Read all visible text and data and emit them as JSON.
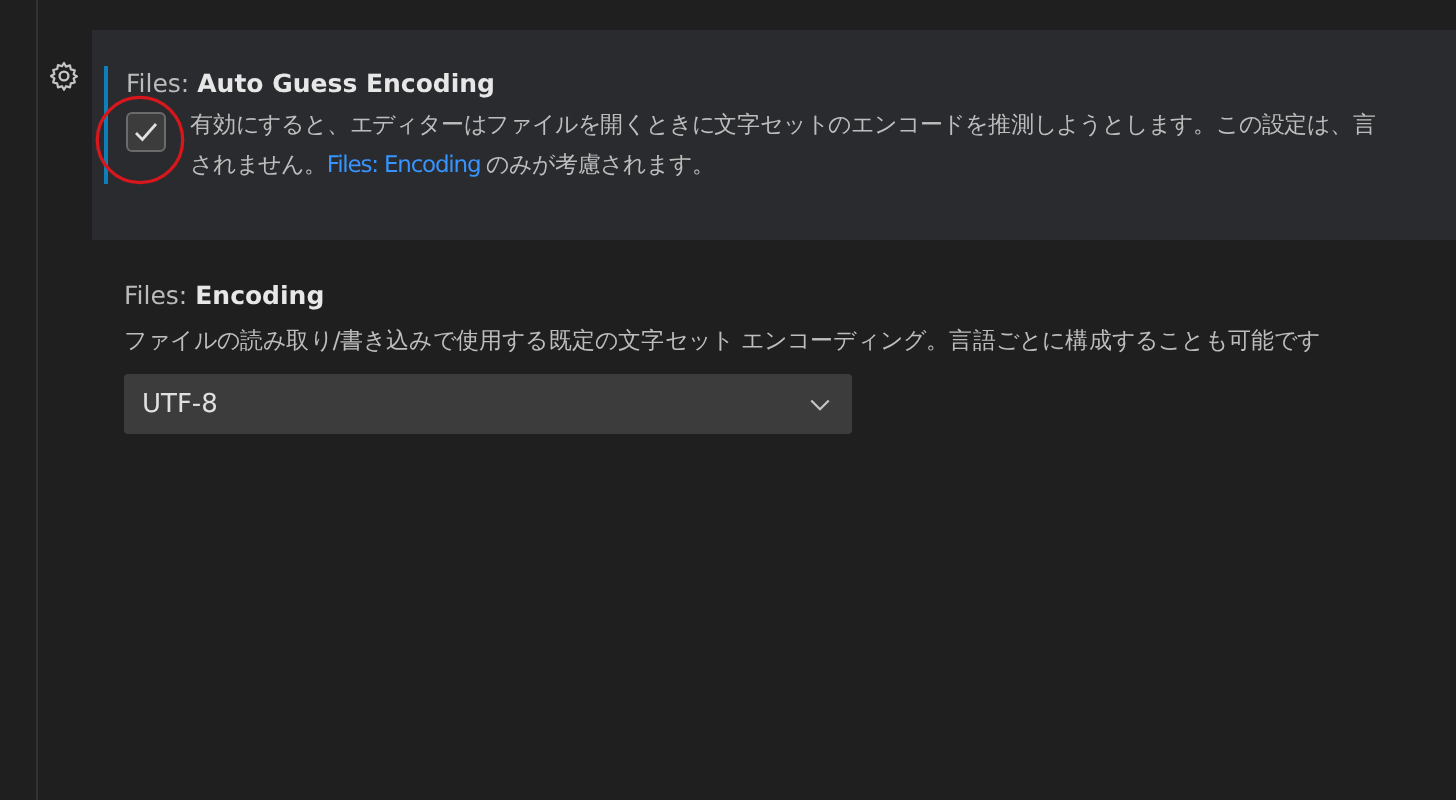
{
  "settings": [
    {
      "kind": "checkbox",
      "focused": true,
      "category": "Files: ",
      "title": "Auto Guess Encoding",
      "checked": true,
      "description": [
        {
          "text": "有効にすると、エディターはファイルを開くときに文字セットのエンコードを推測しようとします。この設定は、言"
        },
        {
          "text": "されません。",
          "link": "Files: Encoding",
          "after": " のみが考慮されます。"
        }
      ]
    },
    {
      "kind": "dropdown",
      "focused": false,
      "category": "Files: ",
      "title": "Encoding",
      "value": "UTF-8",
      "description": [
        {
          "text": "ファイルの読み取り/書き込みで使用する既定の文字セット エンコーディング。言語ごとに構成することも可能です"
        }
      ]
    }
  ]
}
